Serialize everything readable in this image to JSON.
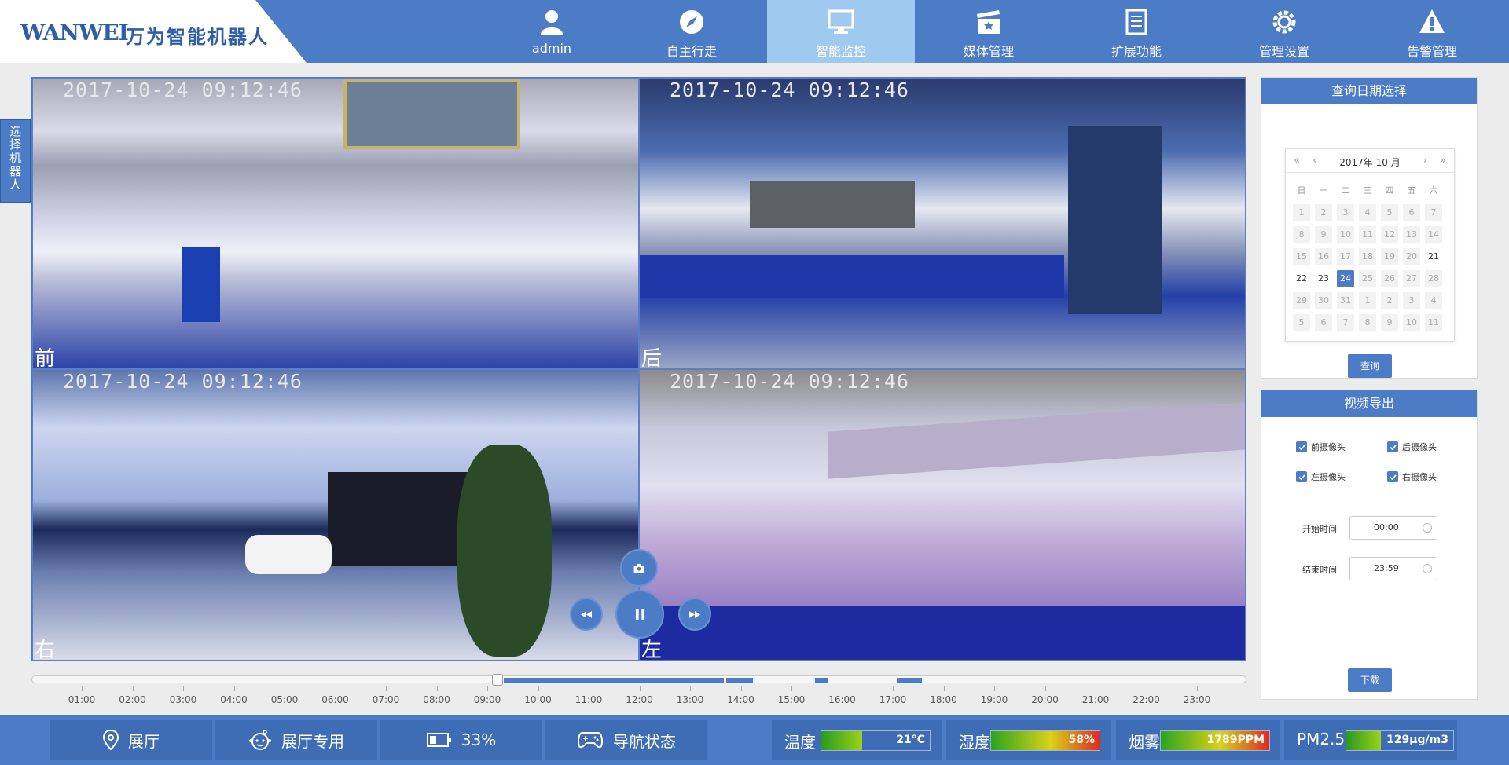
{
  "header": {
    "logo_en": "WANWEI",
    "logo_cn": "万为智能机器人",
    "nav": [
      {
        "label": "admin"
      },
      {
        "label": "自主行走"
      },
      {
        "label": "智能监控"
      },
      {
        "label": "媒体管理"
      },
      {
        "label": "扩展功能"
      },
      {
        "label": "管理设置"
      },
      {
        "label": "告警管理"
      }
    ],
    "active_nav": "智能监控",
    "colors": {
      "bar": "#4d7cc6",
      "active": "#9fc9ef"
    }
  },
  "side_tab": {
    "label": "选择机器人"
  },
  "video": {
    "cameras": [
      {
        "timestamp": "2017-10-24 09:12:46",
        "label": "前"
      },
      {
        "timestamp": "2017-10-24 09:12:46",
        "label": "后"
      },
      {
        "timestamp": "2017-10-24 09:12:46",
        "label": "右"
      },
      {
        "timestamp": "2017-10-24 09:12:46",
        "label": "左"
      }
    ],
    "controls": [
      "camera-icon",
      "rewind-icon",
      "pause-icon",
      "fast-forward-icon"
    ]
  },
  "timeline": {
    "ticks": [
      "01:00",
      "02:00",
      "03:00",
      "04:00",
      "05:00",
      "06:00",
      "07:00",
      "08:00",
      "09:00",
      "10:00",
      "11:00",
      "12:00",
      "13:00",
      "14:00",
      "15:00",
      "16:00",
      "17:00",
      "18:00",
      "19:00",
      "20:00",
      "21:00",
      "22:00",
      "23:00"
    ]
  },
  "date_panel": {
    "title": "查询日期选择",
    "calendar": {
      "year_month": "2017年 10 月",
      "weekdays": [
        "日",
        "一",
        "二",
        "三",
        "四",
        "五",
        "六"
      ],
      "weeks": [
        [
          "1",
          "2",
          "3",
          "4",
          "5",
          "6",
          "7"
        ],
        [
          "8",
          "9",
          "10",
          "11",
          "12",
          "13",
          "14"
        ],
        [
          "15",
          "16",
          "17",
          "18",
          "19",
          "20",
          "21"
        ],
        [
          "22",
          "23",
          "24",
          "25",
          "26",
          "27",
          "28"
        ],
        [
          "29",
          "30",
          "31",
          "1",
          "2",
          "3",
          "4"
        ],
        [
          "5",
          "6",
          "7",
          "8",
          "9",
          "10",
          "11"
        ]
      ],
      "enabled_days": [
        "21",
        "22",
        "23",
        "24"
      ],
      "selected_day": "24"
    },
    "query_label": "查询"
  },
  "export_panel": {
    "title": "视频导出",
    "checkboxes": [
      {
        "label": "前摄像头",
        "checked": true
      },
      {
        "label": "后摄像头",
        "checked": true
      },
      {
        "label": "左摄像头",
        "checked": true
      },
      {
        "label": "右摄像头",
        "checked": true
      }
    ],
    "start_label": "开始时间",
    "start_value": "00:00",
    "end_label": "结束时间",
    "end_value": "23:59",
    "download_label": "下载"
  },
  "footer": {
    "buttons": [
      {
        "label": "展厅",
        "icon": "location-pin-icon"
      },
      {
        "label": "展厅专用",
        "icon": "robot-face-icon"
      },
      {
        "label": "33%",
        "icon": "battery-icon"
      },
      {
        "label": "导航状态",
        "icon": "gamepad-icon"
      }
    ],
    "sensors": [
      {
        "name": "温度",
        "value": "21",
        "unit": "°C",
        "level": 0.38
      },
      {
        "name": "湿度",
        "value": "58%",
        "unit": "",
        "level": 1.0
      },
      {
        "name": "烟雾",
        "value": "1789",
        "unit": "PPM",
        "level": 1.0
      },
      {
        "name": "PM2.5",
        "value": "129",
        "unit": "μg/m3",
        "level": 0.32
      }
    ]
  }
}
